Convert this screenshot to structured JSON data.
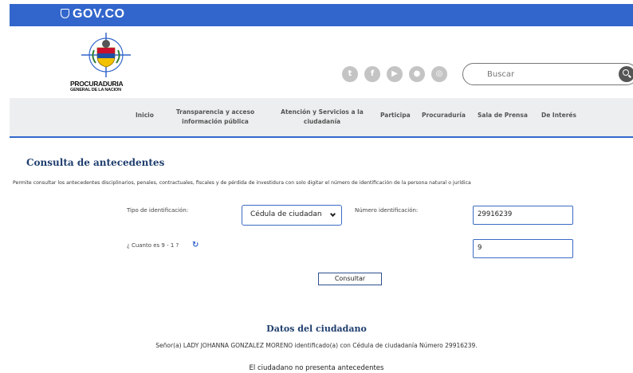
{
  "gov_bar": {
    "brand": "GOV.CO"
  },
  "logo": {
    "name": "PROCURADURIA",
    "subtitle": "GENERAL DE LA NACION"
  },
  "social": [
    "twitter-icon",
    "facebook-icon",
    "youtube-icon",
    "flickr-icon",
    "instagram-icon"
  ],
  "search": {
    "placeholder": "Buscar"
  },
  "nav": {
    "items": [
      {
        "label": "Inicio"
      },
      {
        "label": "Transparencia y acceso\ninformación pública"
      },
      {
        "label": "Atención y Servicios a la\nciudadanía"
      },
      {
        "label": "Participa"
      },
      {
        "label": "Procuraduría"
      },
      {
        "label": "Sala de Prensa"
      },
      {
        "label": "De Interés"
      }
    ]
  },
  "form": {
    "title": "Consulta de antecedentes",
    "description": "Permite consultar los antecedentes disciplinarios, penales, contractuales, fiscales y de pérdida de investidura con solo digitar el número de identificación de la persona natural o jurídica",
    "id_type_label": "Tipo de identificación:",
    "id_type_value": "Cédula de ciudadan",
    "id_number_label": "Número identificación:",
    "id_number_value": "29916239",
    "captcha_label": "¿ Cuanto es 9 - 1 ?",
    "captcha_value": "9",
    "submit_label": "Consultar"
  },
  "result": {
    "title": "Datos del ciudadano",
    "line": "Señor(a)  LADY JOHANNA GONZALEZ MORENO identificado(a) con Cédula de ciudadanía Número 29916239.",
    "status": "El ciudadano no presenta antecedentes"
  },
  "colors": {
    "gov_blue": "#3366cc",
    "title_navy": "#1f3e6e",
    "input_border": "#3c6bc4"
  }
}
